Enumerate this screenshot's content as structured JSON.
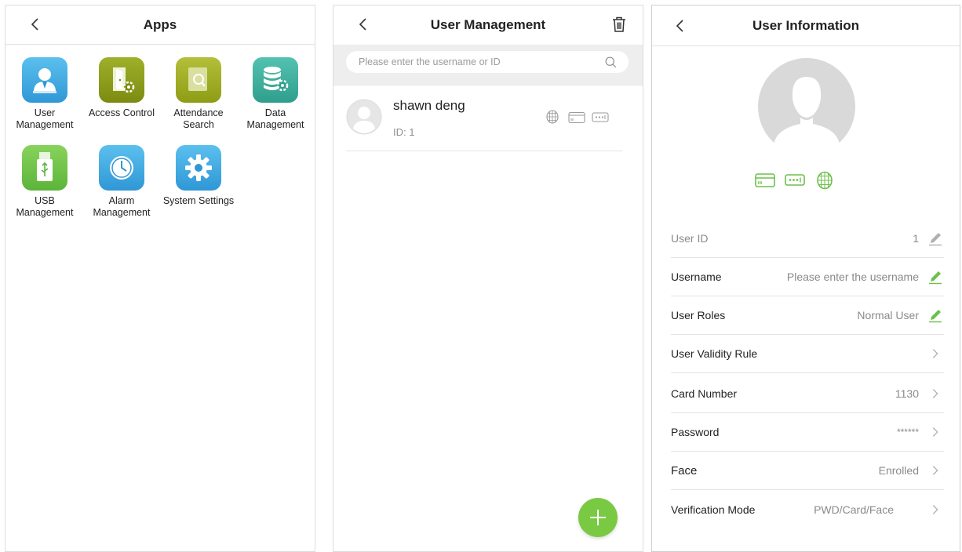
{
  "apps_panel": {
    "title": "Apps",
    "items": [
      {
        "label": "User\nManagement",
        "icon": "user-management-icon",
        "color": "#3aa7de"
      },
      {
        "label": "Access Control",
        "icon": "access-control-icon",
        "color": "#8a9a16"
      },
      {
        "label": "Attendance\nSearch",
        "icon": "attendance-search-icon",
        "color": "#9aa81c"
      },
      {
        "label": "Data\nManagement",
        "icon": "data-management-icon",
        "color": "#3cab9a"
      },
      {
        "label": "USB\nManagement",
        "icon": "usb-icon",
        "color": "#6cc04a"
      },
      {
        "label": "Alarm\nManagement",
        "icon": "alarm-clock-icon",
        "color": "#3aa7de"
      },
      {
        "label": "System Settings",
        "icon": "settings-gear-icon",
        "color": "#3aa7de"
      }
    ]
  },
  "user_management": {
    "title": "User Management",
    "search_placeholder": "Please enter the username or ID",
    "users": [
      {
        "name": "shawn deng",
        "id": "ID: 1"
      }
    ],
    "fab_icon": "plus-icon",
    "accent": "#7ac943"
  },
  "user_information": {
    "title": "User Information",
    "rows": {
      "user_id": {
        "label": "User ID",
        "value": "1"
      },
      "username": {
        "label": "Username",
        "value": "Please enter the username"
      },
      "user_roles": {
        "label": "User Roles",
        "value": "Normal User"
      },
      "validity": {
        "label": "User Validity Rule",
        "value": ""
      },
      "card_number": {
        "label": "Card Number",
        "value": "1130"
      },
      "password": {
        "label": "Password",
        "value": "******"
      },
      "face": {
        "label": "Face",
        "value": "Enrolled"
      },
      "verification": {
        "label": "Verification Mode",
        "value": "PWD/Card/Face"
      }
    },
    "accent": "#6cc04a"
  }
}
